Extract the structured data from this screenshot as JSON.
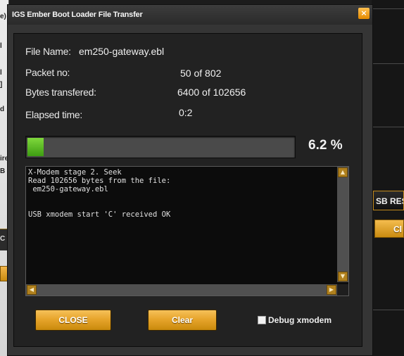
{
  "background": {
    "left_fragments": [
      "e)",
      "l",
      "l",
      "]",
      "d",
      "ire",
      "B",
      "C"
    ],
    "right_button_1": "SB RES",
    "right_button_2": "Cl"
  },
  "dialog": {
    "title": "IGS  Ember Boot Loader File Transfer",
    "close_glyph": "×",
    "file_name_label": "File Name:",
    "file_name": "em250-gateway.ebl",
    "packet_label": "Packet no:",
    "packet_value": "50  of  802",
    "bytes_label": "Bytes transfered:",
    "bytes_value": "6400  of  102656",
    "elapsed_label": "Elapsed time:",
    "elapsed_value": "0:2",
    "progress_percent_text": "6.2 %",
    "progress_fraction": 0.062,
    "progress_color": "#4caf1a",
    "log_text": "X-Modem stage 2. Seek\nRead 102656 bytes from the file:\n em250-gateway.ebl\n\n\nUSB xmodem start 'C' received OK",
    "close_button": "CLOSE",
    "clear_button": "Clear",
    "debug_label": "Debug xmodem",
    "debug_checked": false,
    "accent_color": "#e7a52c"
  }
}
